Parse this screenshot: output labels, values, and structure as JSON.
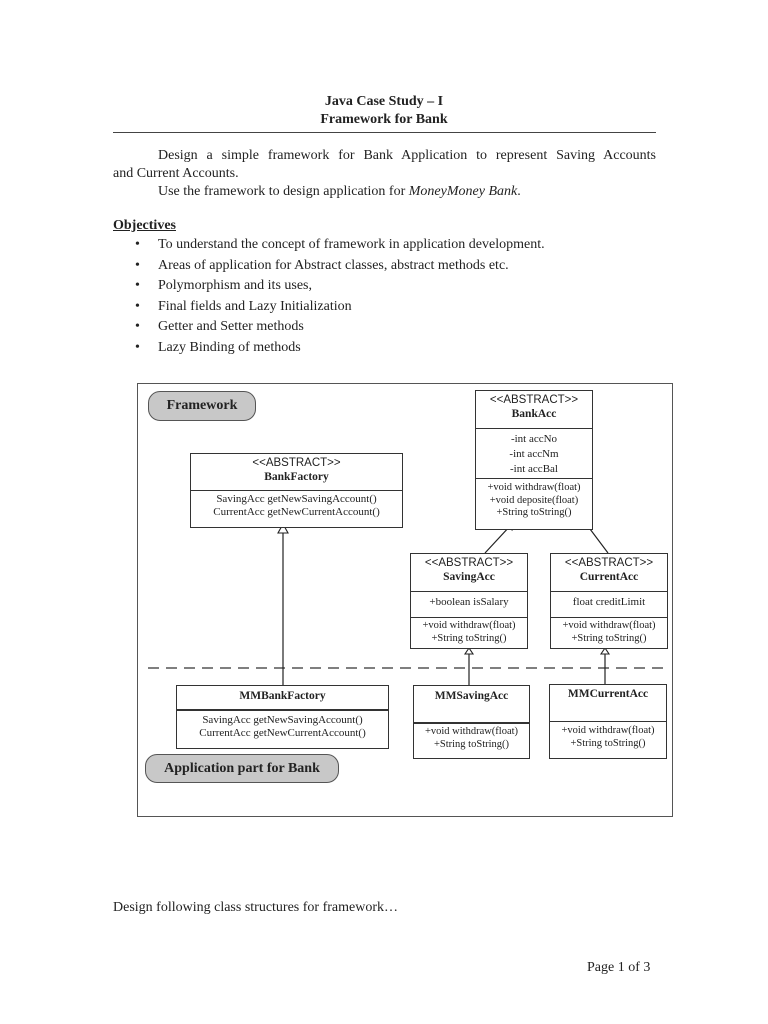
{
  "header": {
    "title_line1": "Java Case Study – I",
    "title_line2": "Framework for Bank"
  },
  "intro": {
    "para1_line1": "Design a simple framework for Bank Application to represent Saving Accounts",
    "para1_line2": "and Current Accounts.",
    "para2_prefix": "Use the framework to design application for ",
    "para2_emphasis": "MoneyMoney Bank",
    "para2_suffix": "."
  },
  "objectives": {
    "heading": "Objectives",
    "bullet_glyph": "•",
    "items": [
      "To understand the concept of framework in application development.",
      "Areas of application for Abstract classes, abstract methods etc.",
      "Polymorphism and its uses,",
      "Final fields and Lazy Initialization",
      "Getter and Setter methods",
      "Lazy Binding of methods"
    ]
  },
  "diagram": {
    "framework_label": "Framework",
    "application_label": "Application part for Bank",
    "classes": {
      "bank_factory": {
        "stereotype": "<<ABSTRACT>>",
        "name": "BankFactory",
        "methods": [
          "SavingAcc getNewSavingAccount()",
          "CurrentAcc getNewCurrentAccount()"
        ]
      },
      "bank_acc": {
        "stereotype": "<<ABSTRACT>>",
        "name": "BankAcc",
        "fields": [
          "-int accNo",
          "-int accNm",
          "-int accBal"
        ],
        "methods": [
          "+void withdraw(float)",
          "+void deposite(float)",
          "+String toString()"
        ]
      },
      "saving_acc": {
        "stereotype": "<<ABSTRACT>>",
        "name": "SavingAcc",
        "fields": [
          "+boolean isSalary"
        ],
        "methods": [
          "+void withdraw(float)",
          "+String toString()"
        ]
      },
      "current_acc": {
        "stereotype": "<<ABSTRACT>>",
        "name": "CurrentAcc",
        "fields": [
          "float creditLimit"
        ],
        "methods": [
          "+void withdraw(float)",
          "+String toString()"
        ]
      },
      "mm_bank_factory": {
        "name": "MMBankFactory",
        "methods": [
          "SavingAcc getNewSavingAccount()",
          "CurrentAcc getNewCurrentAccount()"
        ]
      },
      "mm_saving_acc": {
        "name": "MMSavingAcc",
        "methods": [
          "+void withdraw(float)",
          "+String toString()"
        ]
      },
      "mm_current_acc": {
        "name": "MMCurrentAcc",
        "methods": [
          "+void withdraw(float)",
          "+String toString()"
        ]
      }
    }
  },
  "footer": {
    "closing_text": "Design following class structures for framework…",
    "page_number": "Page 1 of 3"
  }
}
